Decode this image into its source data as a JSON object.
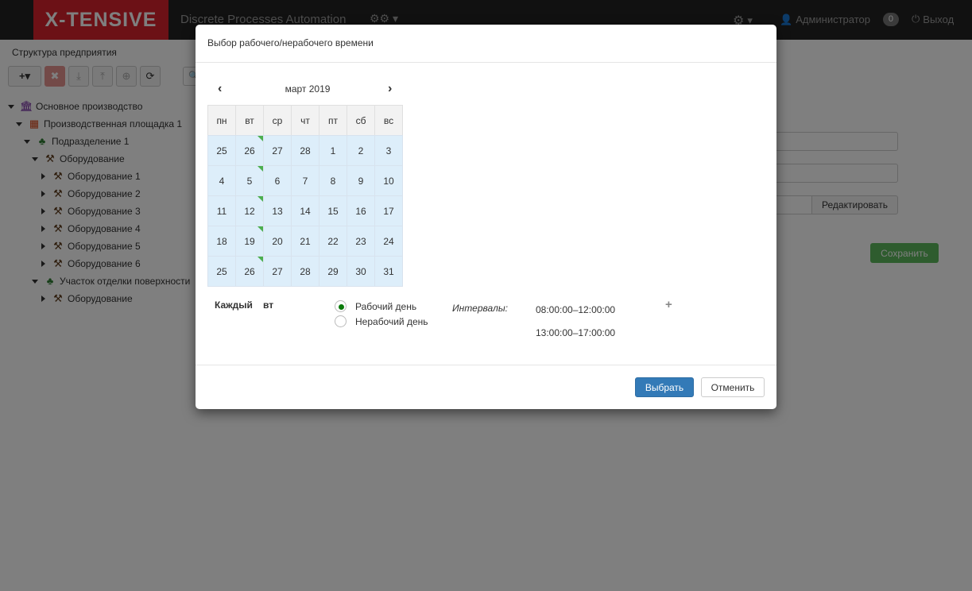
{
  "navbar": {
    "brand": "X-TENSIVE",
    "title": "Discrete Processes Automation",
    "cubes_icon": "cubes-icon",
    "settings_icon": "gear-icon",
    "user_icon": "user-icon",
    "user_name": "Администратор",
    "notifications_count": "0",
    "logout_icon": "power-icon",
    "logout_label": "Выход"
  },
  "left_panel": {
    "title": "Структура предприятия",
    "toolbar": [
      {
        "icon": "add-icon",
        "glyph": "+▾"
      },
      {
        "icon": "delete-icon",
        "glyph": "✖"
      },
      {
        "icon": "download-icon",
        "glyph": "⤓"
      },
      {
        "icon": "upload-icon",
        "glyph": "⤒"
      },
      {
        "icon": "circle-plus-icon",
        "glyph": "⊕"
      },
      {
        "icon": "refresh-icon",
        "glyph": "⟳"
      }
    ],
    "search_icon": "search-icon",
    "tree": [
      {
        "label": "Основное производство",
        "icon": "bank-icon",
        "expanded": true
      },
      {
        "label": "Производственная площадка 1",
        "icon": "building-icon",
        "expanded": true
      },
      {
        "label": "Подразделение 1",
        "icon": "org-chart-icon",
        "expanded": true
      },
      {
        "label": "Оборудование",
        "icon": "hammer-icon",
        "expanded": true
      },
      {
        "label": "Оборудование 1",
        "icon": "hammer-icon",
        "expanded": false
      },
      {
        "label": "Оборудование 2",
        "icon": "hammer-icon",
        "expanded": false
      },
      {
        "label": "Оборудование 3",
        "icon": "hammer-icon",
        "expanded": false
      },
      {
        "label": "Оборудование 4",
        "icon": "hammer-icon",
        "expanded": false
      },
      {
        "label": "Оборудование 5",
        "icon": "hammer-icon",
        "expanded": false
      },
      {
        "label": "Оборудование 6",
        "icon": "hammer-icon",
        "expanded": false
      },
      {
        "label": "Участок отделки поверхности",
        "icon": "org-chart-icon",
        "expanded": true
      },
      {
        "label": "Оборудование",
        "icon": "hammer-icon",
        "expanded": false
      }
    ]
  },
  "right_form": {
    "edit_button": "Редактировать",
    "save_button": "Сохранить"
  },
  "modal": {
    "title": "Выбор рабочего/нерабочего времени",
    "calendar": {
      "month_label": "март 2019",
      "weekdays": [
        "пн",
        "вт",
        "ср",
        "чт",
        "пт",
        "сб",
        "вс"
      ],
      "weeks": [
        [
          "25",
          "26",
          "27",
          "28",
          "1",
          "2",
          "3"
        ],
        [
          "4",
          "5",
          "6",
          "7",
          "8",
          "9",
          "10"
        ],
        [
          "11",
          "12",
          "13",
          "14",
          "15",
          "16",
          "17"
        ],
        [
          "18",
          "19",
          "20",
          "21",
          "22",
          "23",
          "24"
        ],
        [
          "25",
          "26",
          "27",
          "28",
          "29",
          "30",
          "31"
        ]
      ],
      "flagged_column": 1
    },
    "every_label": "Каждый",
    "every_day": "вт",
    "radio_working": "Рабочий день",
    "radio_nonworking": "Нерабочий день",
    "selected": "working",
    "intervals_label": "Интервалы:",
    "intervals": [
      "08:00:00–12:00:00",
      "13:00:00–17:00:00"
    ],
    "add_interval_glyph": "+",
    "choose_button": "Выбрать",
    "cancel_button": "Отменить"
  },
  "colors": {
    "brand_red": "#d9232d",
    "navbar": "#222222",
    "calendar_cell": "#ddeefa",
    "flag_green": "#4caf50",
    "primary": "#337ab7",
    "success": "#5cb85c"
  }
}
